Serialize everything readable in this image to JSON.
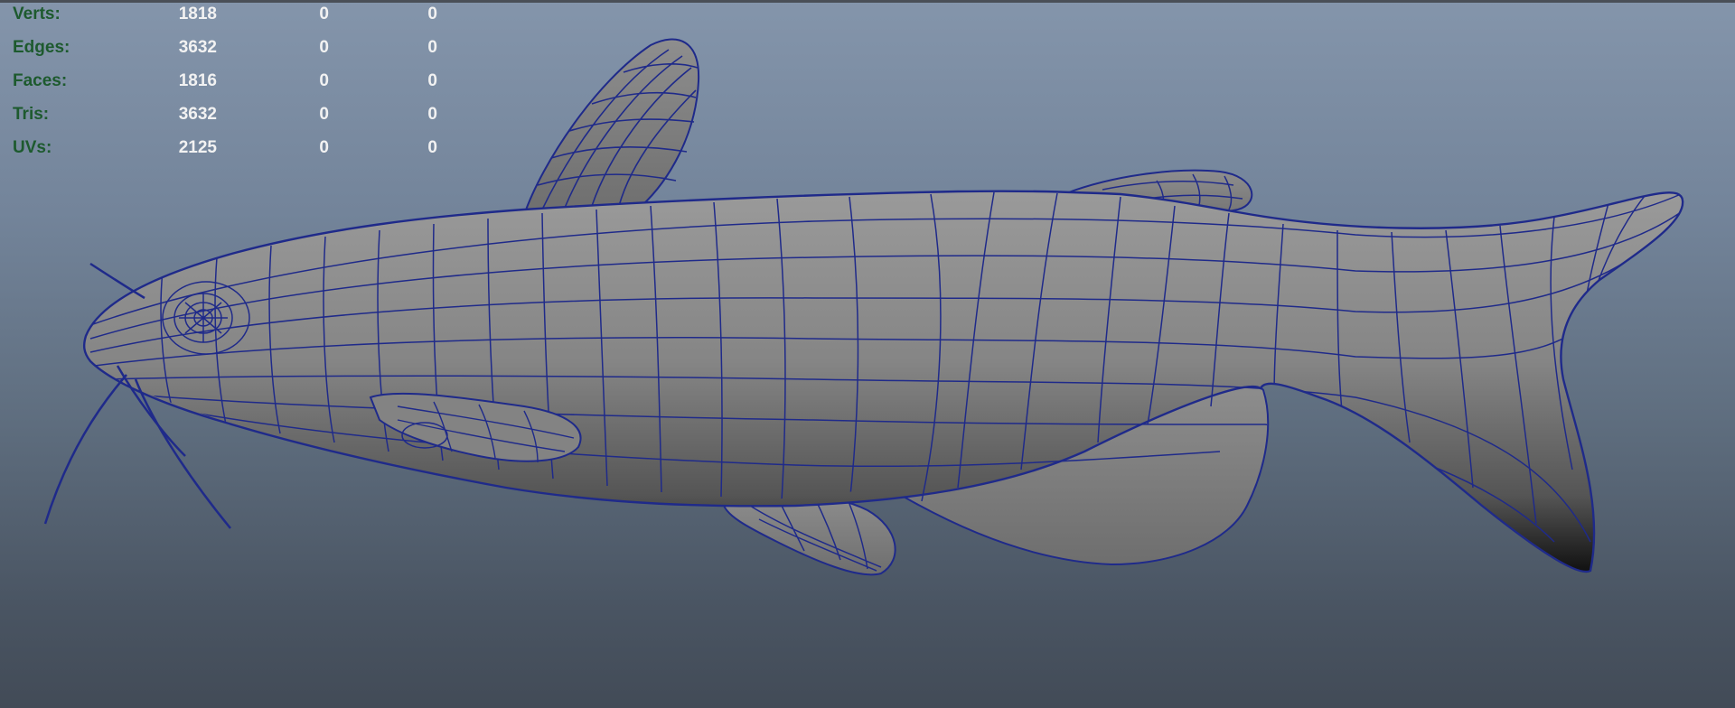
{
  "viewport": {
    "background_top": "#8495ab",
    "background_bottom": "#424b57",
    "wireframe_color": "#1f2a8a",
    "shade_color": "#8a8a8a"
  },
  "hud": {
    "rows": [
      {
        "label": "Verts:",
        "total": "1818",
        "selected": "0",
        "other": "0"
      },
      {
        "label": "Edges:",
        "total": "3632",
        "selected": "0",
        "other": "0"
      },
      {
        "label": "Faces:",
        "total": "1816",
        "selected": "0",
        "other": "0"
      },
      {
        "label": "Tris:",
        "total": "3632",
        "selected": "0",
        "other": "0"
      },
      {
        "label": "UVs:",
        "total": "2125",
        "selected": "0",
        "other": "0"
      }
    ]
  }
}
